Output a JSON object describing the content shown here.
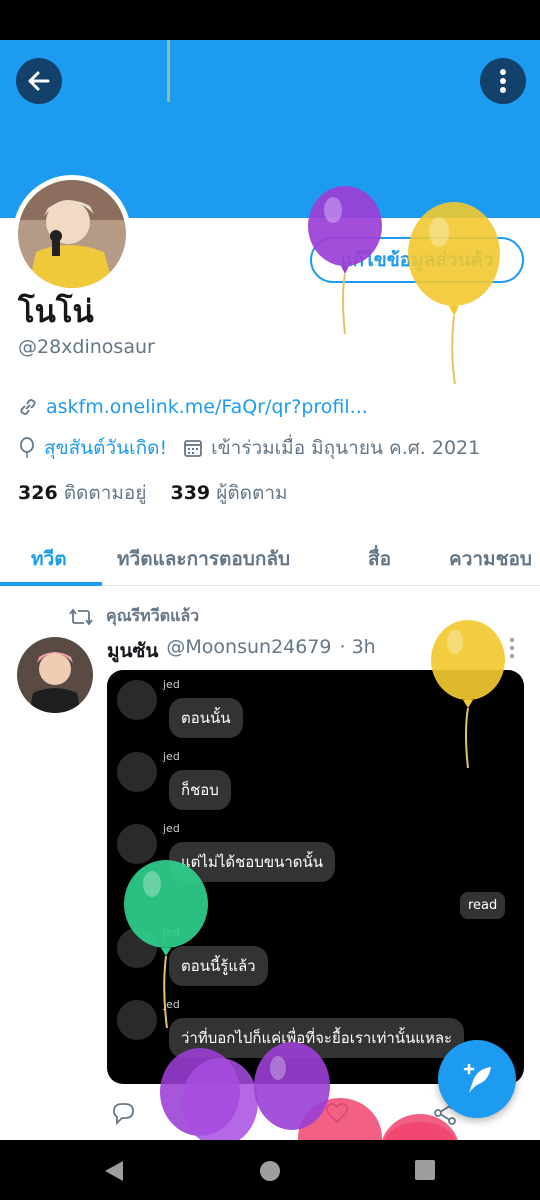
{
  "profile": {
    "name": "โนโน่",
    "handle": "@28xdinosaur",
    "edit_label": "แก้ไขข้อมูลส่วนตัว",
    "link": "askfm.onelink.me/FaQr/qr?profil...",
    "birthday": "สุขสันต์วันเกิด!",
    "joined": "เข้าร่วมเมื่อ มิถุนายน ค.ศ. 2021",
    "following_count": "326",
    "following_label": "ติดตามอยู่",
    "followers_count": "339",
    "followers_label": "ผู้ติดตาม"
  },
  "tabs": [
    {
      "label": "ทวีต"
    },
    {
      "label": "ทวีตและการตอบกลับ"
    },
    {
      "label": "สื่อ"
    },
    {
      "label": "ความชอบ"
    }
  ],
  "tweet": {
    "retweet_label": "คุณรีทวีตแล้ว",
    "display_name": "มูนซัน",
    "username": "@Moonsun24679",
    "time": "· 3h"
  },
  "chat": {
    "name": "jed",
    "messages": [
      "ตอนนั้น",
      "ก็ชอบ",
      "แต่ไม่ได้ชอบขนาดนั้น",
      "ตอนนี้รู้แล้ว",
      "ว่าที่บอกไปก็แค่เพื่อที่จะยื้อเราเท่านั้นแหละ"
    ],
    "read_label": "read"
  },
  "colors": {
    "accent": "#1d9bf0",
    "balloon_purple": "#9b3fd6",
    "balloon_yellow": "#f2c930",
    "balloon_green": "#2fcf8c",
    "balloon_pink": "#f0446e"
  },
  "icons": [
    "back-arrow-icon",
    "more-vertical-icon",
    "link-icon",
    "balloon-icon",
    "calendar-icon",
    "retweet-icon",
    "reply-icon",
    "like-icon",
    "share-icon",
    "compose-icon"
  ]
}
